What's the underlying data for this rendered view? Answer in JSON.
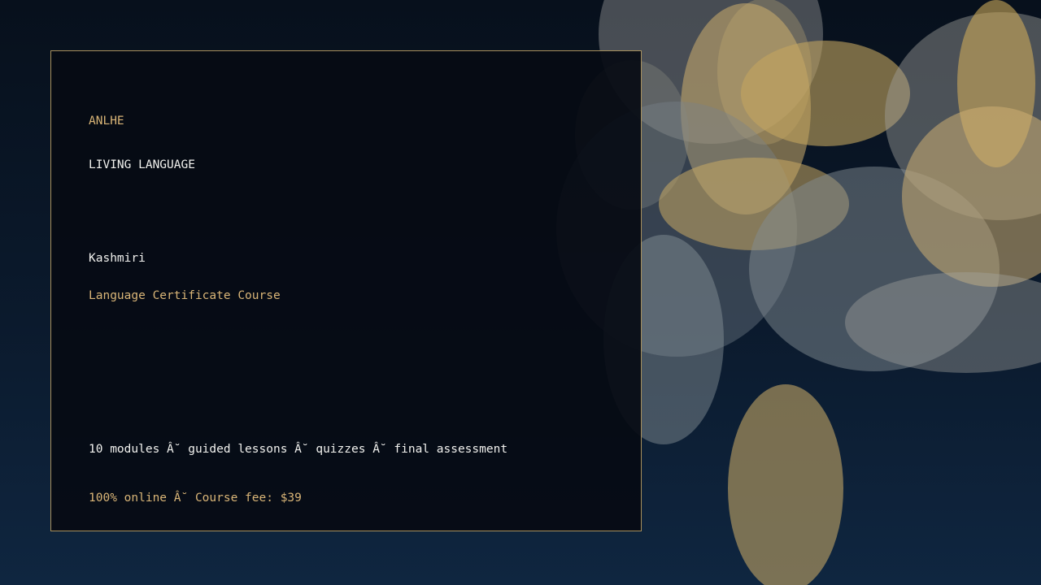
{
  "card": {
    "brand": "ANLHE",
    "tagline": "LIVING LANGUAGE",
    "language": "Kashmiri",
    "course_title": "Language Certificate Course",
    "details": "10 modules Â˘ guided lessons Â˘ quizzes Â˘ final assessment",
    "fee_line": "100% online Â˘ Course fee: $39"
  },
  "colors": {
    "accent_gold": "#d9b577",
    "text_white": "#f1f1ee",
    "card_border": "#a8905c",
    "bg_top": "#07101c",
    "bg_bottom": "#0f2640"
  }
}
